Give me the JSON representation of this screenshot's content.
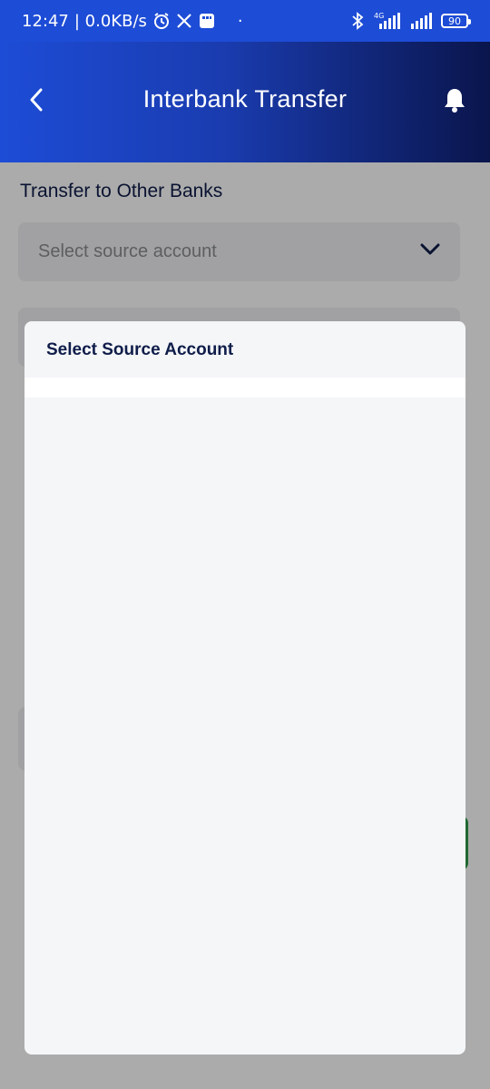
{
  "status_bar": {
    "time": "12:47",
    "speed": "| 0.0KB/s",
    "dot": "·",
    "network": "4G",
    "battery": "90"
  },
  "header": {
    "title": "Interbank Transfer",
    "back_icon": "chevron-left-icon",
    "notification_icon": "bell-icon"
  },
  "form": {
    "section_title": "Transfer to Other Banks",
    "source_account": {
      "placeholder": "Select source account",
      "icon": "chevron-down-icon"
    }
  },
  "modal": {
    "title": "Select Source Account",
    "items": []
  },
  "colors": {
    "status_bar": "#1d4cd6",
    "header_start": "#1d4cd6",
    "header_end": "#0a154c",
    "text_navy": "#0f1d4a",
    "scrim": "rgba(0,0,0,0.33)"
  }
}
